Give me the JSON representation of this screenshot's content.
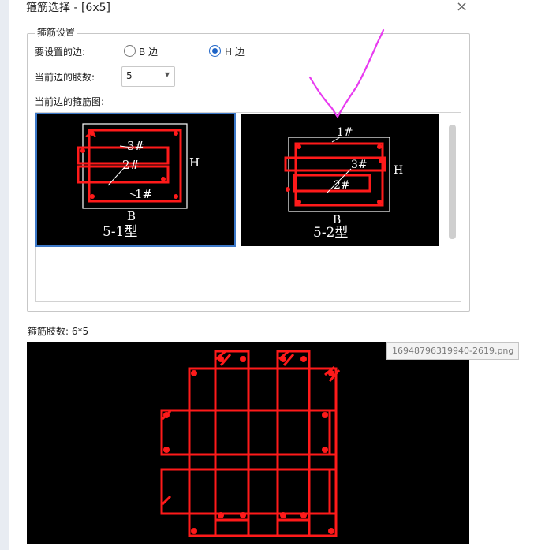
{
  "window": {
    "title": "箍筋选择 - [6x5]",
    "close_glyph": "×"
  },
  "settings": {
    "group_title": "箍筋设置",
    "side_label": "要设置的边:",
    "side_options": [
      {
        "label": "B 边",
        "checked": false
      },
      {
        "label": "H 边",
        "checked": true
      }
    ],
    "count_label": "当前边的肢数:",
    "count_value": "5",
    "figure_label": "当前边的箍筋图:"
  },
  "thumbnails": [
    {
      "caption": "5-1型",
      "labels": [
        "3#",
        "2#",
        "1#"
      ],
      "b_label": "B",
      "h_label": "H",
      "selected": true
    },
    {
      "caption": "5-2型",
      "labels": [
        "1#",
        "3#",
        "2#"
      ],
      "b_label": "B",
      "h_label": "H",
      "selected": false
    }
  ],
  "summary": {
    "label": "箍筋肢数: 6*5"
  },
  "filename_tooltip": "16948796319940-2619.png",
  "colors": {
    "accent": "#1d63c6",
    "rebar": "#ff1a1a",
    "annotation": "#e83bf0"
  }
}
